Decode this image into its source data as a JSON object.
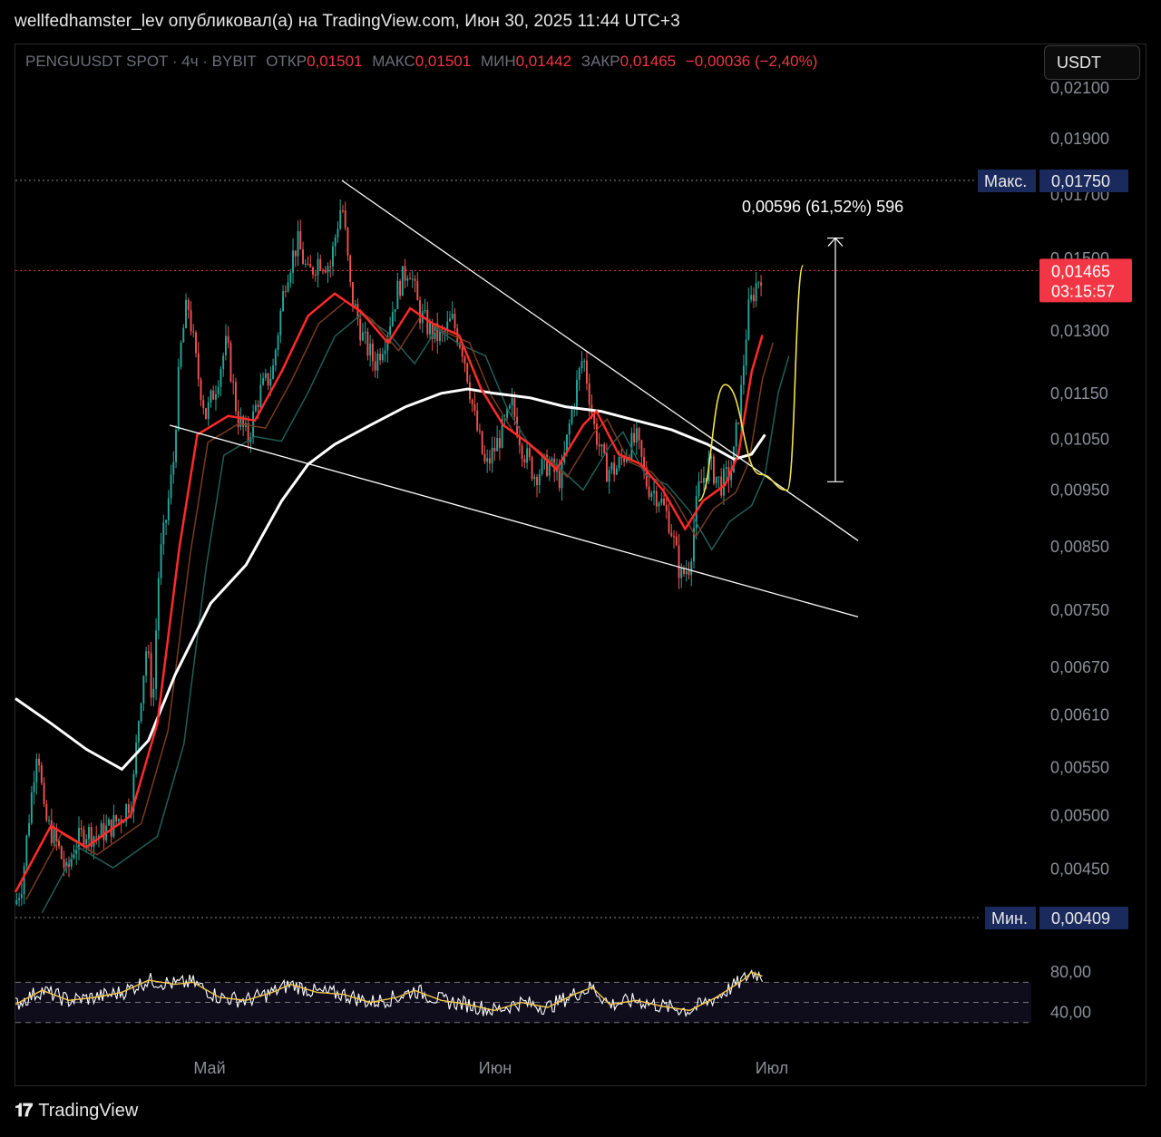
{
  "header": {
    "publish_line": "wellfedhamster_lev опубликовал(а) на TradingView.com, Июн 30, 2025 11:44 UTC+3"
  },
  "legend": {
    "symbol": "PENGUUSDT SPOT · 4ч · BYBIT",
    "open_label": "ОТКР",
    "open_value": "0,01501",
    "high_label": "МАКС",
    "high_value": "0,01501",
    "low_label": "МИН",
    "low_value": "0,01442",
    "close_label": "ЗАКР",
    "close_value": "0,01465",
    "change": "−0,00036 (−2,40%)"
  },
  "currency_button": "USDT",
  "price_axis": {
    "ticks": [
      "0,02100",
      "0,01900",
      "0,01700",
      "0,01500",
      "0,01300",
      "0,01150",
      "0,01050",
      "0,00950",
      "0,00850",
      "0,00750",
      "0,00670",
      "0,00610",
      "0,00550",
      "0,00500",
      "0,00450"
    ],
    "max_label": "Макс.",
    "max_value": "0,01750",
    "min_label": "Мин.",
    "min_value": "0,00409",
    "current_price": "0,01465",
    "countdown": "03:15:57"
  },
  "measure_label": "0,00596 (61,52%) 596",
  "rsi_axis": {
    "ticks": [
      "80,00",
      "40,00"
    ]
  },
  "time_axis": {
    "labels": [
      "Май",
      "Июн",
      "Июл"
    ]
  },
  "footer": {
    "brand": "TradingView"
  },
  "colors": {
    "up": "#26a69a",
    "down": "#ef5350",
    "ema_fast": "#ff2a2a",
    "ema_mid": "#7a3b1e",
    "ema_slow": "#1f5f5a",
    "ma_long": "#ffffff",
    "projection": "#f2e34c",
    "rsi": "#ffffff",
    "rsi_ma": "#f2c84b",
    "current_price_bg": "#f23645",
    "extreme_bg": "#1b2a5c"
  },
  "chart_data": {
    "type": "candlestick",
    "symbol": "PENGUUSDT",
    "timeframe": "4ч",
    "y_range": [
      0.00409,
      0.0175
    ],
    "max": 0.0175,
    "min": 0.00409,
    "last_close": 0.01465,
    "price_path": [
      [
        0.0,
        0.0042
      ],
      [
        0.008,
        0.0044
      ],
      [
        0.018,
        0.0052
      ],
      [
        0.025,
        0.0058
      ],
      [
        0.032,
        0.005
      ],
      [
        0.04,
        0.00485
      ],
      [
        0.048,
        0.0047
      ],
      [
        0.058,
        0.00445
      ],
      [
        0.066,
        0.0047
      ],
      [
        0.078,
        0.00485
      ],
      [
        0.092,
        0.0048
      ],
      [
        0.108,
        0.0049
      ],
      [
        0.12,
        0.005
      ],
      [
        0.132,
        0.0052
      ],
      [
        0.14,
        0.0062
      ],
      [
        0.148,
        0.007
      ],
      [
        0.155,
        0.0062
      ],
      [
        0.162,
        0.0082
      ],
      [
        0.17,
        0.009
      ],
      [
        0.178,
        0.01
      ],
      [
        0.186,
        0.0125
      ],
      [
        0.194,
        0.0138
      ],
      [
        0.205,
        0.012
      ],
      [
        0.215,
        0.011
      ],
      [
        0.226,
        0.0117
      ],
      [
        0.238,
        0.0127
      ],
      [
        0.25,
        0.011
      ],
      [
        0.262,
        0.0105
      ],
      [
        0.275,
        0.0115
      ],
      [
        0.29,
        0.012
      ],
      [
        0.305,
        0.0145
      ],
      [
        0.318,
        0.0155
      ],
      [
        0.33,
        0.0145
      ],
      [
        0.342,
        0.015
      ],
      [
        0.355,
        0.0148
      ],
      [
        0.368,
        0.0168
      ],
      [
        0.378,
        0.014
      ],
      [
        0.392,
        0.0128
      ],
      [
        0.405,
        0.0122
      ],
      [
        0.418,
        0.0129
      ],
      [
        0.432,
        0.0142
      ],
      [
        0.444,
        0.0148
      ],
      [
        0.455,
        0.0135
      ],
      [
        0.468,
        0.013
      ],
      [
        0.48,
        0.0128
      ],
      [
        0.492,
        0.0133
      ],
      [
        0.505,
        0.0125
      ],
      [
        0.517,
        0.011
      ],
      [
        0.53,
        0.0099
      ],
      [
        0.545,
        0.0105
      ],
      [
        0.56,
        0.0112
      ],
      [
        0.572,
        0.0103
      ],
      [
        0.585,
        0.0098
      ],
      [
        0.6,
        0.01
      ],
      [
        0.615,
        0.0097
      ],
      [
        0.628,
        0.0112
      ],
      [
        0.64,
        0.0124
      ],
      [
        0.652,
        0.0108
      ],
      [
        0.665,
        0.0099
      ],
      [
        0.677,
        0.0099
      ],
      [
        0.69,
        0.0103
      ],
      [
        0.7,
        0.0105
      ],
      [
        0.712,
        0.0096
      ],
      [
        0.725,
        0.0094
      ],
      [
        0.738,
        0.0089
      ],
      [
        0.75,
        0.008
      ],
      [
        0.76,
        0.0082
      ],
      [
        0.77,
        0.0095
      ],
      [
        0.782,
        0.01
      ],
      [
        0.795,
        0.0096
      ],
      [
        0.808,
        0.0099
      ],
      [
        0.818,
        0.0115
      ],
      [
        0.826,
        0.0135
      ],
      [
        0.834,
        0.0142
      ],
      [
        0.842,
        0.01465
      ]
    ],
    "ema_fast_path": [
      [
        0.0,
        0.0043
      ],
      [
        0.04,
        0.0049
      ],
      [
        0.08,
        0.0047
      ],
      [
        0.13,
        0.005
      ],
      [
        0.16,
        0.006
      ],
      [
        0.185,
        0.0085
      ],
      [
        0.205,
        0.0106
      ],
      [
        0.24,
        0.011
      ],
      [
        0.27,
        0.0109
      ],
      [
        0.3,
        0.012
      ],
      [
        0.33,
        0.0134
      ],
      [
        0.36,
        0.014
      ],
      [
        0.39,
        0.0135
      ],
      [
        0.42,
        0.0127
      ],
      [
        0.445,
        0.0136
      ],
      [
        0.47,
        0.0132
      ],
      [
        0.5,
        0.0129
      ],
      [
        0.525,
        0.0116
      ],
      [
        0.55,
        0.0108
      ],
      [
        0.58,
        0.0104
      ],
      [
        0.61,
        0.0099
      ],
      [
        0.64,
        0.0108
      ],
      [
        0.655,
        0.0111
      ],
      [
        0.68,
        0.0102
      ],
      [
        0.705,
        0.01
      ],
      [
        0.73,
        0.0095
      ],
      [
        0.755,
        0.0088
      ],
      [
        0.775,
        0.0093
      ],
      [
        0.8,
        0.0096
      ],
      [
        0.815,
        0.0102
      ],
      [
        0.83,
        0.012
      ],
      [
        0.842,
        0.0129
      ]
    ],
    "ma_long_path": [
      [
        0.0,
        0.0063
      ],
      [
        0.04,
        0.006
      ],
      [
        0.08,
        0.0057
      ],
      [
        0.12,
        0.00548
      ],
      [
        0.15,
        0.0058
      ],
      [
        0.18,
        0.0066
      ],
      [
        0.22,
        0.0076
      ],
      [
        0.26,
        0.0082
      ],
      [
        0.3,
        0.0093
      ],
      [
        0.33,
        0.01
      ],
      [
        0.36,
        0.0104
      ],
      [
        0.4,
        0.0108
      ],
      [
        0.44,
        0.0112
      ],
      [
        0.48,
        0.0115
      ],
      [
        0.51,
        0.0116
      ],
      [
        0.54,
        0.0115
      ],
      [
        0.58,
        0.0114
      ],
      [
        0.62,
        0.0112
      ],
      [
        0.66,
        0.0111
      ],
      [
        0.7,
        0.0109
      ],
      [
        0.74,
        0.0107
      ],
      [
        0.78,
        0.0104
      ],
      [
        0.81,
        0.0101
      ],
      [
        0.83,
        0.0102
      ],
      [
        0.845,
        0.0106
      ]
    ],
    "upper_trendline": [
      [
        0.368,
        0.0175
      ],
      [
        0.95,
        0.0086
      ]
    ],
    "lower_trendline": [
      [
        0.174,
        0.0108
      ],
      [
        0.95,
        0.0074
      ]
    ],
    "projection_path": [
      [
        0.77,
        0.0093
      ],
      [
        0.8,
        0.0117
      ],
      [
        0.84,
        0.0098
      ],
      [
        0.87,
        0.0095
      ],
      [
        0.888,
        0.0148
      ]
    ],
    "measure": {
      "from": 0.00966,
      "to": 0.01562,
      "change": "0,00596 (61,52%) 596"
    },
    "rsi": {
      "levels": [
        70,
        50,
        30
      ],
      "ticks": [
        80,
        40
      ],
      "last_value": 78,
      "path": [
        [
          0.0,
          48
        ],
        [
          0.03,
          62
        ],
        [
          0.06,
          52
        ],
        [
          0.09,
          55
        ],
        [
          0.12,
          60
        ],
        [
          0.15,
          72
        ],
        [
          0.18,
          68
        ],
        [
          0.2,
          70
        ],
        [
          0.23,
          55
        ],
        [
          0.26,
          52
        ],
        [
          0.29,
          60
        ],
        [
          0.31,
          68
        ],
        [
          0.34,
          60
        ],
        [
          0.37,
          58
        ],
        [
          0.4,
          50
        ],
        [
          0.43,
          55
        ],
        [
          0.45,
          62
        ],
        [
          0.48,
          52
        ],
        [
          0.51,
          48
        ],
        [
          0.54,
          42
        ],
        [
          0.57,
          50
        ],
        [
          0.6,
          45
        ],
        [
          0.63,
          58
        ],
        [
          0.65,
          65
        ],
        [
          0.67,
          48
        ],
        [
          0.7,
          52
        ],
        [
          0.73,
          46
        ],
        [
          0.76,
          42
        ],
        [
          0.79,
          55
        ],
        [
          0.82,
          72
        ],
        [
          0.83,
          80
        ],
        [
          0.842,
          76
        ]
      ]
    }
  }
}
